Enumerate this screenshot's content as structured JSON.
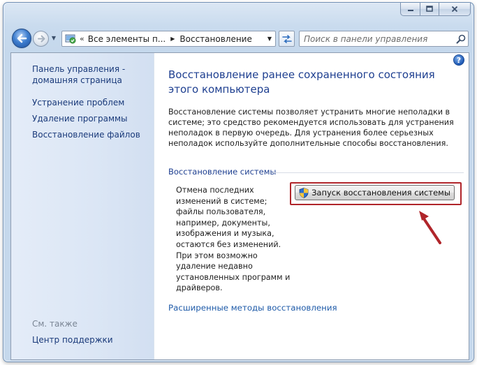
{
  "window": {
    "caption_buttons": {
      "minimize_icon": "minimize-icon",
      "maximize_icon": "maximize-icon",
      "close_icon": "close-icon"
    }
  },
  "navigation": {
    "back_icon": "back-arrow-icon",
    "forward_icon": "forward-arrow-icon",
    "address": {
      "crumbs": [
        "Все элементы п...",
        "Восстановление"
      ],
      "separator": "«"
    },
    "search": {
      "placeholder": "Поиск в панели управления"
    }
  },
  "left_pane": {
    "home_link": "Панель управления - домашняя страница",
    "links": [
      "Устранение проблем",
      "Удаление программы",
      "Восстановление файлов"
    ],
    "see_also_label": "См. также",
    "see_also_links": [
      "Центр поддержки"
    ]
  },
  "main": {
    "title": "Восстановление ранее сохраненного состояния этого компьютера",
    "description": "Восстановление системы позволяет устранить многие неполадки в системе; это средство рекомендуется использовать для устранения неполадок в первую очередь. Для устранения более серьезных неполадок используйте дополнительные способы восстановления.",
    "section": {
      "header": "Восстановление системы",
      "text": "Отмена последних изменений в системе; файлы пользователя, например, документы, изображения и музыка, остаются без изменений. При этом возможно удаление недавно установленных программ и драйверов.",
      "button_label": "Запуск восстановления системы"
    },
    "advanced_link": "Расширенные методы восстановления"
  },
  "colors": {
    "link": "#1e5aa8",
    "title": "#1e3f90",
    "highlight": "#b0252a"
  }
}
